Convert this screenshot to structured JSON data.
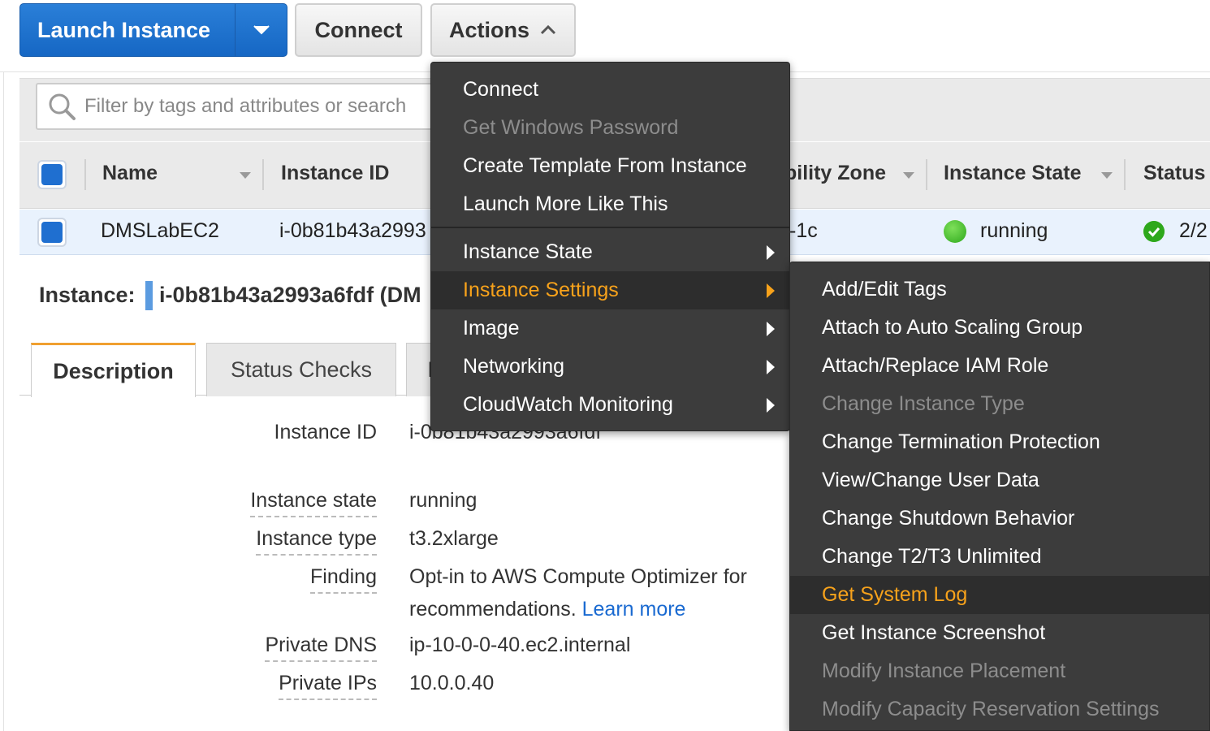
{
  "toolbar": {
    "launch_label": "Launch Instance",
    "connect_label": "Connect",
    "actions_label": "Actions"
  },
  "filter": {
    "placeholder": "Filter by tags and attributes or search"
  },
  "table": {
    "headers": {
      "name": "Name",
      "instance_id": "Instance ID",
      "availability_zone": "bility Zone",
      "instance_state": "Instance State",
      "status": "Status"
    },
    "row": {
      "name": "DMSLabEC2",
      "instance_id": "i-0b81b43a2993",
      "availability_zone": "-1c",
      "instance_state": "running",
      "status": "2/2"
    }
  },
  "instance_panel": {
    "title_label": "Instance:",
    "title_id": "i-0b81b43a2993a6fdf (DM",
    "tabs": [
      "Description",
      "Status Checks",
      "I"
    ],
    "details": {
      "instance_id_label": "Instance ID",
      "instance_id_value": "i-0b81b43a2993a6fdf",
      "instance_state_label": "Instance state",
      "instance_state_value": "running",
      "instance_type_label": "Instance type",
      "instance_type_value": "t3.2xlarge",
      "finding_label": "Finding",
      "finding_value_line1": "Opt-in to AWS Compute Optimizer for",
      "finding_value_line2": "recommendations.",
      "finding_link": "Learn more",
      "private_dns_label": "Private DNS",
      "private_dns_value": "ip-10-0-0-40.ec2.internal",
      "private_ips_label": "Private IPs",
      "private_ips_value": "10.0.0.40"
    }
  },
  "actions_menu": {
    "items": [
      {
        "label": "Connect",
        "state": "enabled"
      },
      {
        "label": "Get Windows Password",
        "state": "disabled"
      },
      {
        "label": "Create Template From Instance",
        "state": "enabled"
      },
      {
        "label": "Launch More Like This",
        "state": "enabled"
      },
      {
        "label": "Instance State",
        "state": "submenu"
      },
      {
        "label": "Instance Settings",
        "state": "active-submenu"
      },
      {
        "label": "Image",
        "state": "submenu"
      },
      {
        "label": "Networking",
        "state": "submenu"
      },
      {
        "label": "CloudWatch Monitoring",
        "state": "submenu"
      }
    ]
  },
  "instance_settings_submenu": {
    "items": [
      {
        "label": "Add/Edit Tags",
        "state": "enabled"
      },
      {
        "label": "Attach to Auto Scaling Group",
        "state": "enabled"
      },
      {
        "label": "Attach/Replace IAM Role",
        "state": "enabled"
      },
      {
        "label": "Change Instance Type",
        "state": "disabled"
      },
      {
        "label": "Change Termination Protection",
        "state": "enabled"
      },
      {
        "label": "View/Change User Data",
        "state": "enabled"
      },
      {
        "label": "Change Shutdown Behavior",
        "state": "enabled"
      },
      {
        "label": "Change T2/T3 Unlimited",
        "state": "enabled"
      },
      {
        "label": "Get System Log",
        "state": "hovered"
      },
      {
        "label": "Get Instance Screenshot",
        "state": "enabled"
      },
      {
        "label": "Modify Instance Placement",
        "state": "disabled"
      },
      {
        "label": "Modify Capacity Reservation Settings",
        "state": "disabled"
      }
    ]
  },
  "colors": {
    "primary_button": "#1f6fd0",
    "menu_bg": "#3c3c3c",
    "menu_highlight_text": "#f7a21b",
    "running_dot": "#2ea81c",
    "link": "#1a6ad1"
  }
}
